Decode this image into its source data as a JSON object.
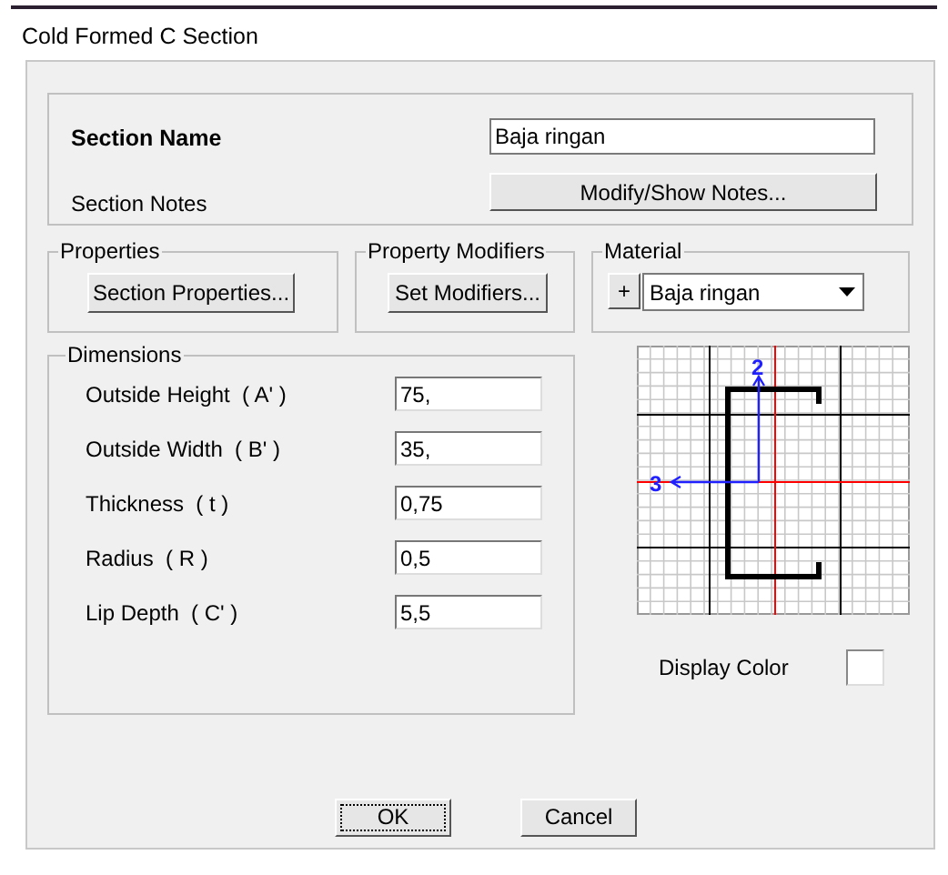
{
  "window": {
    "title": "Cold Formed C Section"
  },
  "section": {
    "name_label": "Section Name",
    "name_value": "Baja ringan",
    "notes_label": "Section Notes",
    "notes_button": "Modify/Show Notes..."
  },
  "properties": {
    "legend": "Properties",
    "button": "Section Properties..."
  },
  "property_modifiers": {
    "legend": "Property Modifiers",
    "button": "Set Modifiers..."
  },
  "material": {
    "legend": "Material",
    "add_button": "+",
    "value": "Baja ringan"
  },
  "dimensions": {
    "legend": "Dimensions",
    "fields": [
      {
        "label": "Outside Height  ( A' )",
        "value": "75,"
      },
      {
        "label": "Outside Width  ( B' )",
        "value": "35,"
      },
      {
        "label": "Thickness  ( t )",
        "value": "0,75"
      },
      {
        "label": "Radius  ( R )",
        "value": "0,5"
      },
      {
        "label": "Lip Depth  ( C' )",
        "value": "5,5"
      }
    ]
  },
  "diagram": {
    "axis_labels": [
      "2",
      "3"
    ]
  },
  "display_color": {
    "label": "Display Color"
  },
  "buttons": [
    {
      "label": "OK",
      "focused": true
    },
    {
      "label": "Cancel",
      "focused": false
    }
  ]
}
